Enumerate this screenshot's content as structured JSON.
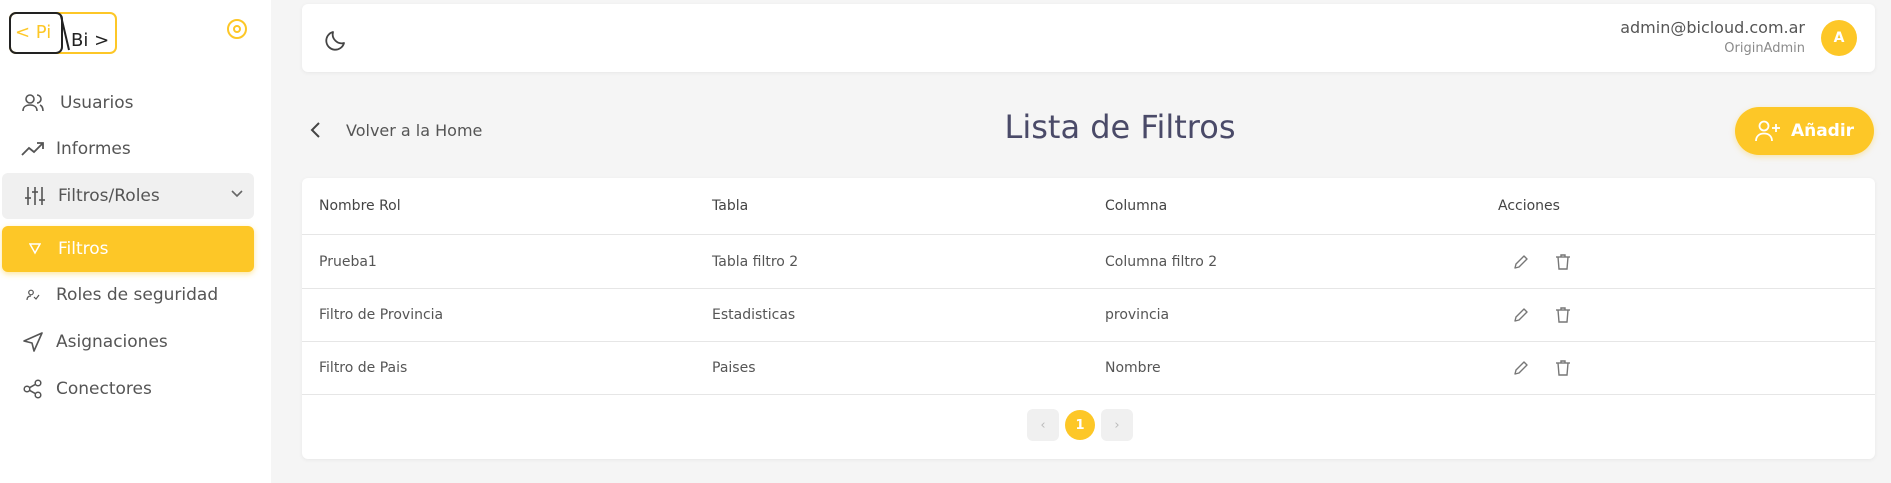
{
  "brand": {
    "logo_left": "< Pi",
    "logo_right": "Bi >",
    "accent": "#fdc727"
  },
  "sidebar": {
    "items": [
      {
        "label": "Usuarios",
        "icon": "users-icon"
      },
      {
        "label": "Informes",
        "icon": "trending-up-icon"
      },
      {
        "label": "Filtros/Roles",
        "icon": "sliders-icon",
        "expanded": true
      },
      {
        "label": "Filtros",
        "icon": "filter-icon",
        "active": true
      },
      {
        "label": "Roles de seguridad",
        "icon": "user-shield-icon"
      },
      {
        "label": "Asignaciones",
        "icon": "send-icon"
      },
      {
        "label": "Conectores",
        "icon": "share-icon"
      }
    ]
  },
  "topbar": {
    "user_email": "admin@bicloud.com.ar",
    "user_role": "OriginAdmin",
    "avatar_initial": "A"
  },
  "header": {
    "back_label": "Volver a la Home",
    "title": "Lista de Filtros",
    "add_label": "Añadir"
  },
  "table": {
    "columns": [
      "Nombre Rol",
      "Tabla",
      "Columna",
      "Acciones"
    ],
    "rows": [
      [
        "Prueba1",
        "Tabla filtro 2",
        "Columna filtro 2"
      ],
      [
        "Filtro de Provincia",
        "Estadisticas",
        "provincia"
      ],
      [
        "Filtro de Pais",
        "Paises",
        "Nombre"
      ]
    ]
  },
  "pagination": {
    "prev": "‹",
    "current": "1",
    "next": "›"
  }
}
